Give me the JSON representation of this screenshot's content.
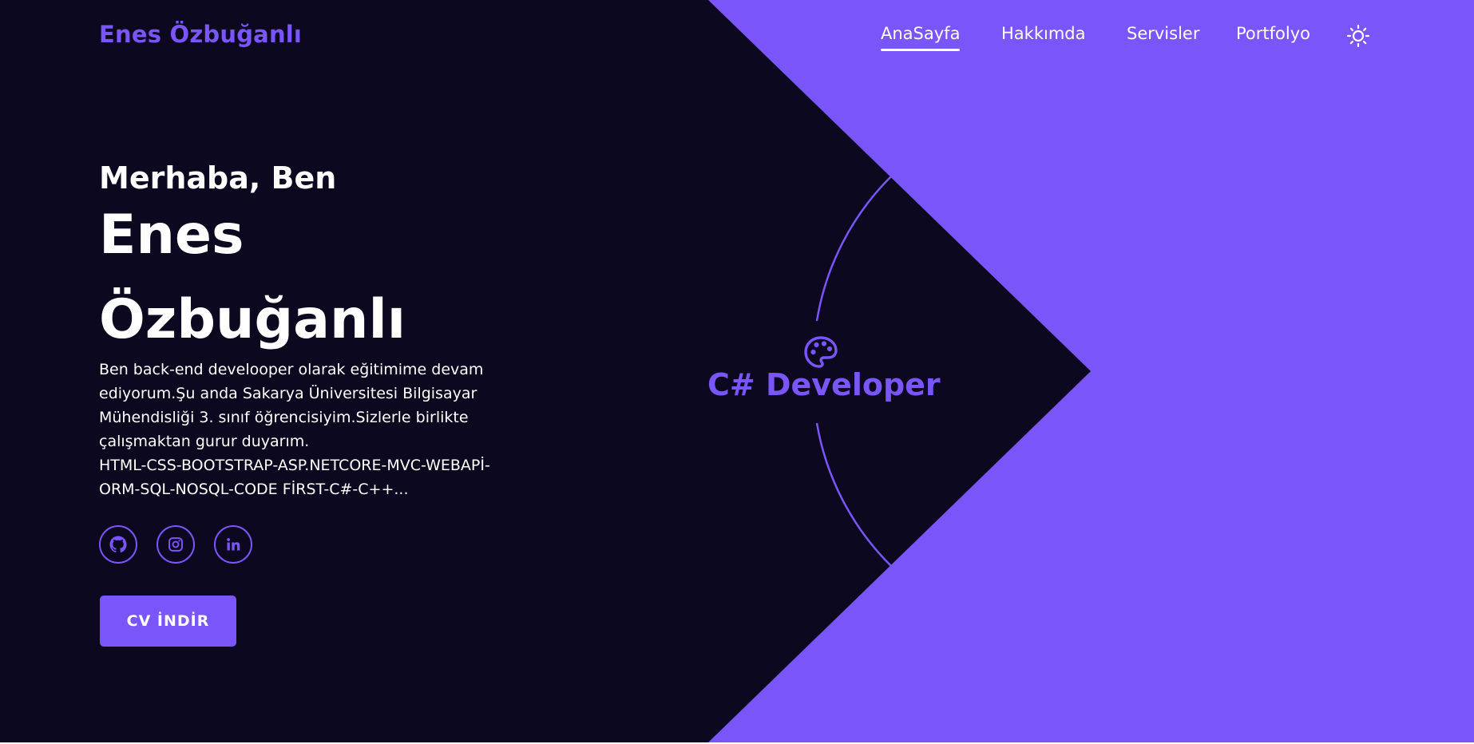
{
  "header": {
    "logo": "Enes Özbuğanlı",
    "nav": [
      {
        "label": "AnaSayfa",
        "active": true
      },
      {
        "label": "Hakkımda",
        "active": false
      },
      {
        "label": "Servisler",
        "active": false
      },
      {
        "label": "Portfolyo",
        "active": false
      }
    ],
    "theme_toggle_icon": "sun-icon"
  },
  "hero": {
    "greeting": "Merhaba, Ben",
    "name_first": "Enes",
    "name_last": "Özbuğanlı",
    "bio_lines": [
      "Ben back-end develooper olarak eğitimime devam",
      "ediyorum.Şu anda Sakarya Üniversitesi Bilgisayar",
      "Mühendisliği 3. sınıf öğrencisiyim.Sizlerle birlikte",
      "çalışmaktan gurur duyarım.",
      "HTML-CSS-BOOTSTRAP-ASP.NETCORE-MVC-WEBAPİ-",
      "ORM-SQL-NOSQL-CODE FİRST-C#-C++..."
    ],
    "socials": [
      {
        "icon": "github-icon"
      },
      {
        "icon": "instagram-icon"
      },
      {
        "icon": "linkedin-icon"
      }
    ],
    "cv_button": "CV İNDİR",
    "badge": {
      "icon": "palette-icon",
      "text": "C# Developer"
    }
  },
  "colors": {
    "accent": "#7a55f9",
    "background": "#0b0820",
    "text": "#ffffff"
  }
}
